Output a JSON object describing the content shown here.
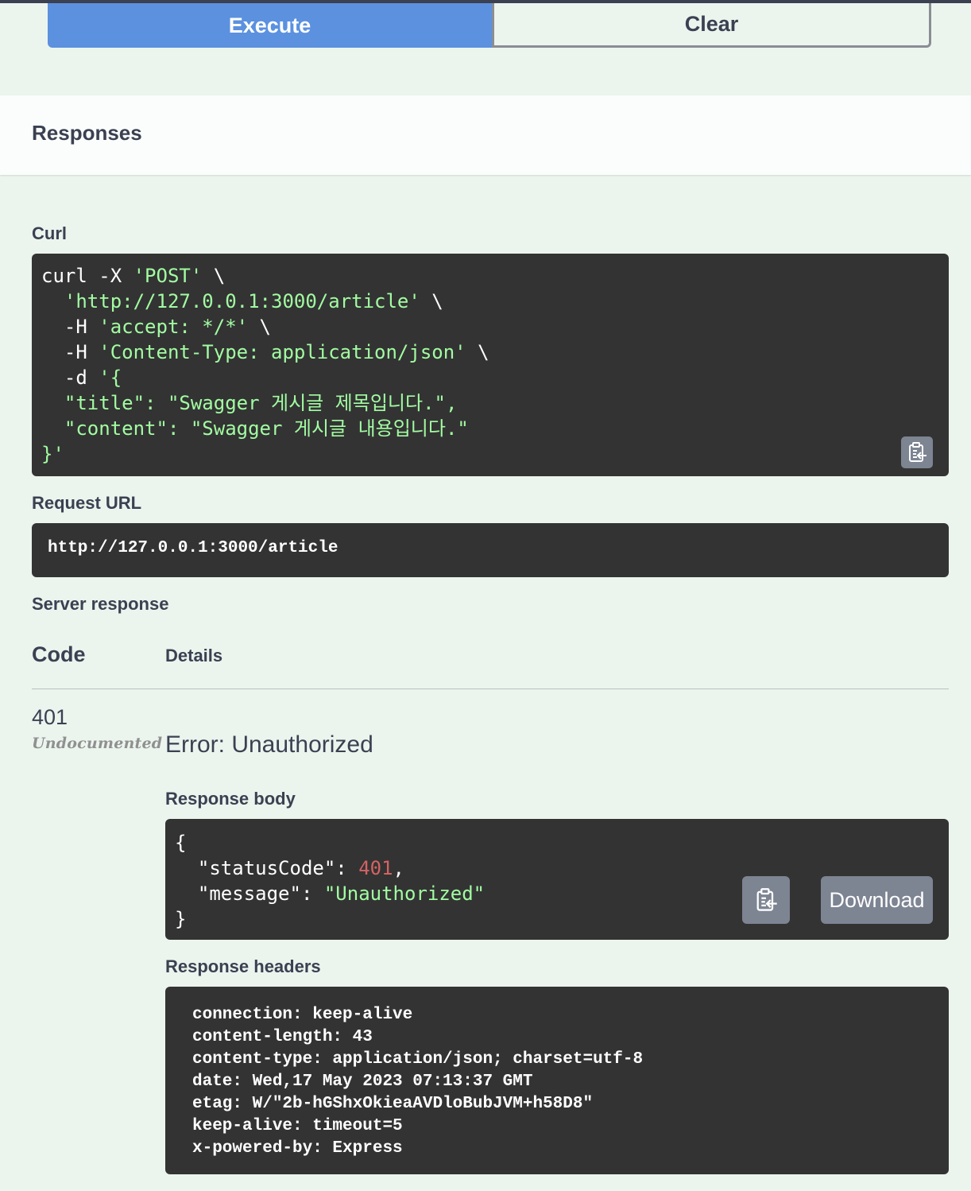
{
  "buttons": {
    "execute": "Execute",
    "clear": "Clear"
  },
  "responses_title": "Responses",
  "curl": {
    "label": "Curl",
    "lines": [
      [
        {
          "t": "curl -X ",
          "c": "w"
        },
        {
          "t": "'POST'",
          "c": "g"
        },
        {
          "t": " \\",
          "c": "w"
        }
      ],
      [
        {
          "t": "  ",
          "c": "w"
        },
        {
          "t": "'http://127.0.0.1:3000/article'",
          "c": "g"
        },
        {
          "t": " \\",
          "c": "w"
        }
      ],
      [
        {
          "t": "  -H ",
          "c": "w"
        },
        {
          "t": "'accept: */*'",
          "c": "g"
        },
        {
          "t": " \\",
          "c": "w"
        }
      ],
      [
        {
          "t": "  -H ",
          "c": "w"
        },
        {
          "t": "'Content-Type: application/json'",
          "c": "g"
        },
        {
          "t": " \\",
          "c": "w"
        }
      ],
      [
        {
          "t": "  -d ",
          "c": "w"
        },
        {
          "t": "'{",
          "c": "g"
        }
      ],
      [
        {
          "t": "  \"title\": \"Swagger 게시글 제목입니다.\",",
          "c": "g"
        }
      ],
      [
        {
          "t": "  \"content\": \"Swagger 게시글 내용입니다.\"",
          "c": "g"
        }
      ],
      [
        {
          "t": "}'",
          "c": "g"
        }
      ]
    ]
  },
  "request_url": {
    "label": "Request URL",
    "value": "http://127.0.0.1:3000/article"
  },
  "server_response": {
    "label": "Server response",
    "columns": {
      "code": "Code",
      "details": "Details"
    },
    "status_code": "401",
    "undocumented": "Undocumented",
    "error": "Error: Unauthorized",
    "body_label": "Response body",
    "body_lines": [
      [
        {
          "t": "{",
          "c": "w"
        }
      ],
      [
        {
          "t": "  \"statusCode\": ",
          "c": "w"
        },
        {
          "t": "401",
          "c": "r"
        },
        {
          "t": ",",
          "c": "w"
        }
      ],
      [
        {
          "t": "  \"message\": ",
          "c": "w"
        },
        {
          "t": "\"Unauthorized\"",
          "c": "g"
        }
      ],
      [
        {
          "t": "}",
          "c": "w"
        }
      ]
    ],
    "download": "Download",
    "headers_label": "Response headers",
    "headers_lines": [
      "connection: keep-alive",
      "content-length: 43",
      "content-type: application/json; charset=utf-8",
      "date: Wed,17 May 2023 07:13:37 GMT",
      "etag: W/\"2b-hGShxOkieaAVDloBubJVM+h58D8\"",
      "keep-alive: timeout=5",
      "x-powered-by: Express"
    ]
  },
  "icons": {
    "copy": "clipboard-copy-icon"
  },
  "colors": {
    "execute": "#5b91df",
    "code_bg": "#333333",
    "string": "#a2fca2",
    "number": "#d36363",
    "page_bg": "#ebf5ee"
  }
}
